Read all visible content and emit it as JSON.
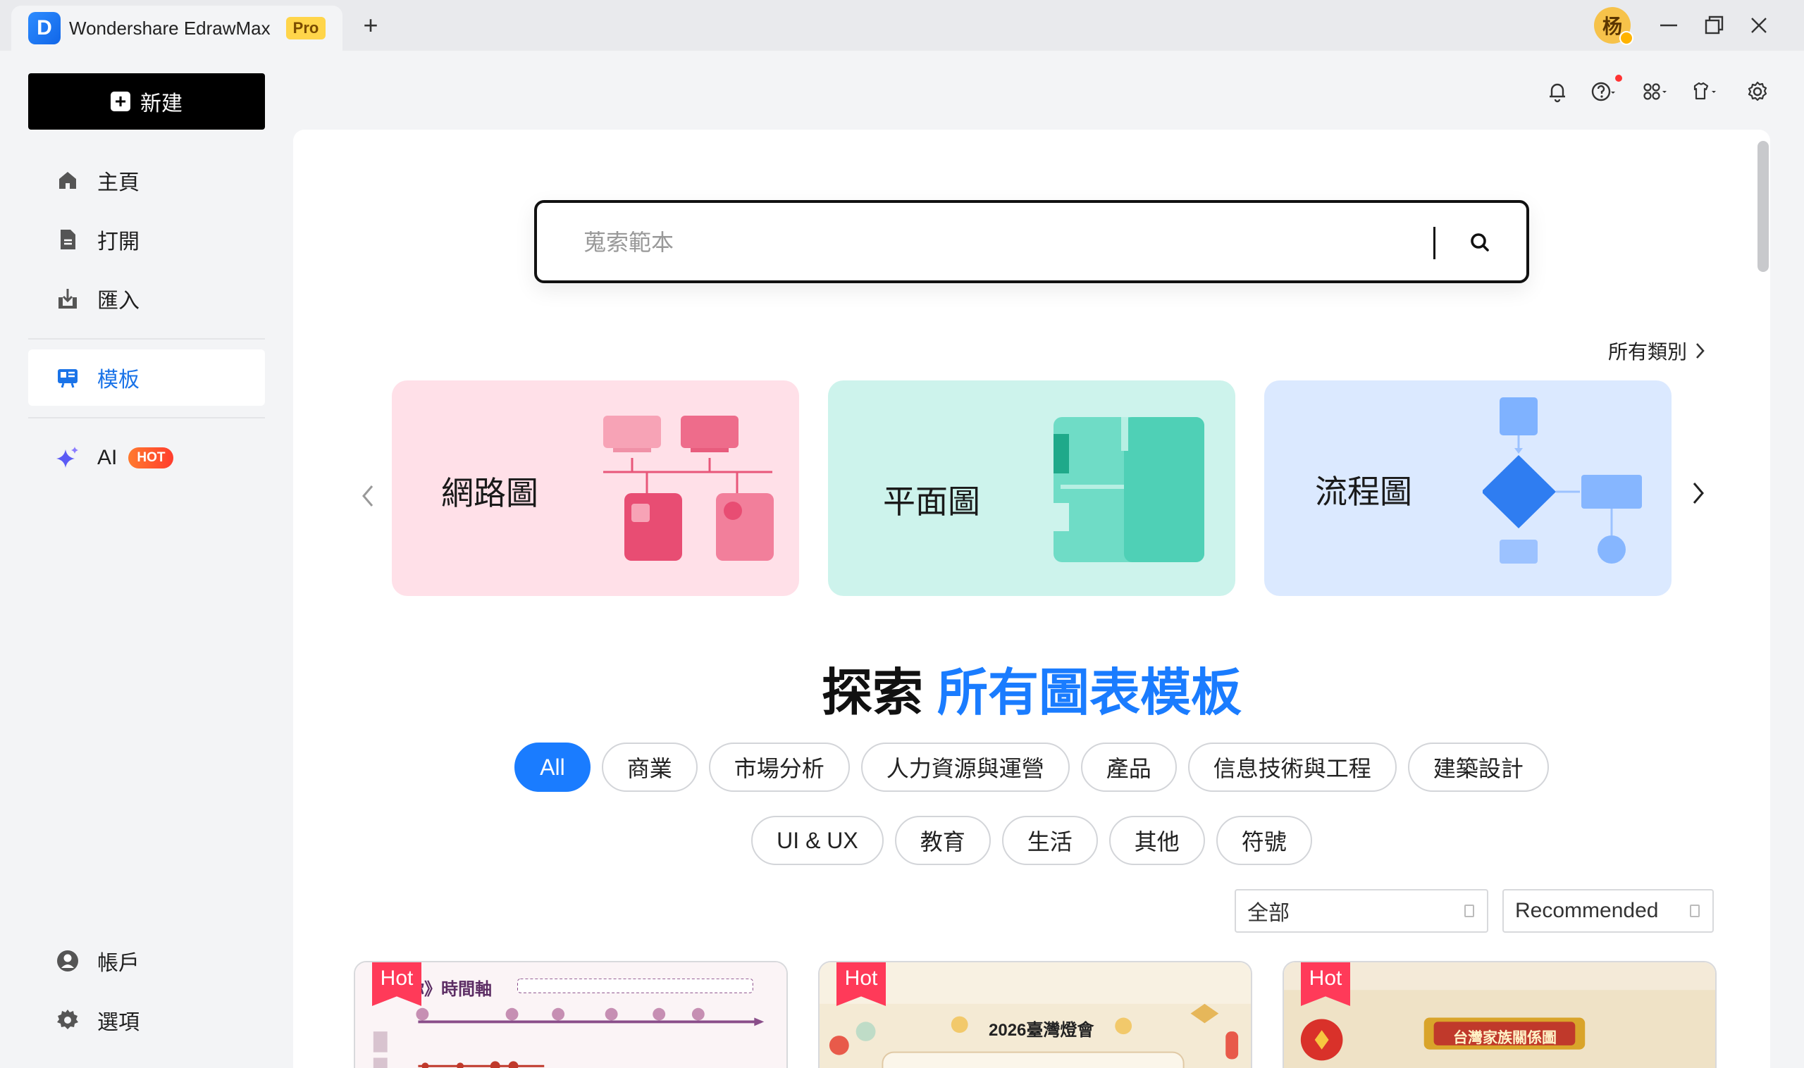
{
  "window": {
    "app_name": "Wondershare EdrawMax",
    "edition_badge": "Pro",
    "new_tab": "+",
    "avatar_initial": "杨"
  },
  "sidebar": {
    "new_label": "新建",
    "items": [
      {
        "label": "主頁",
        "icon": "home-icon"
      },
      {
        "label": "打開",
        "icon": "file-icon"
      },
      {
        "label": "匯入",
        "icon": "import-icon"
      },
      {
        "label": "模板",
        "icon": "template-icon",
        "active": true
      },
      {
        "label": "AI",
        "icon": "sparkle-icon",
        "badge": "HOT"
      },
      {
        "label": "帳戶",
        "icon": "user-icon"
      },
      {
        "label": "選項",
        "icon": "gear-icon"
      }
    ]
  },
  "search": {
    "placeholder": "蒐索範本"
  },
  "categories": {
    "all_link": "所有類別",
    "cards": [
      {
        "label": "網路圖"
      },
      {
        "label": "平面圖"
      },
      {
        "label": "流程圖"
      }
    ]
  },
  "explore": {
    "title_black": "探索",
    "title_blue": "所有圖表模板"
  },
  "filters": {
    "row1": [
      "All",
      "商業",
      "市場分析",
      "人力資源與運營",
      "產品",
      "信息技術與工程",
      "建築設計"
    ],
    "row2": [
      "UI & UX",
      "教育",
      "生活",
      "其他",
      "符號"
    ],
    "active": "All",
    "scope_value": "全部",
    "sort_value": "Recommended"
  },
  "templates": [
    {
      "tag": "Hot",
      "title": "你》時間軸"
    },
    {
      "tag": "Hot",
      "title": "2026臺灣燈會"
    },
    {
      "tag": "Hot",
      "title": "台灣家族關係圖"
    }
  ],
  "colors": {
    "accent": "#1a7cff",
    "hot": "#ff3a59",
    "network_card": "#ffe0e8",
    "floor_card": "#cdf3ec",
    "flow_card": "#dbe9ff"
  }
}
